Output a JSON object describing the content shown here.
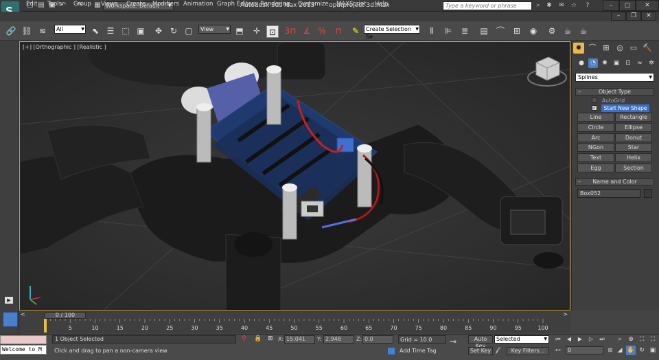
{
  "title_bar": {
    "app_title": "Autodesk 3ds Max 2013",
    "file_name": "opatproject 3d.max",
    "workspace_label": "Workspace: Default",
    "search_placeholder": "Type a keyword or phrase"
  },
  "menu": [
    "Edit",
    "Tools",
    "Group",
    "Views",
    "Create",
    "Modifiers",
    "Animation",
    "Graph Editors",
    "Rendering",
    "Customize",
    "MAXScript",
    "Help"
  ],
  "toolbar": {
    "selection_filter": "All",
    "reference_coord": "View",
    "named_selection": "Create Selection Se",
    "snap_label": "3"
  },
  "viewport": {
    "label": "[+] [Orthographic ] [Realistic ]"
  },
  "command_panel": {
    "category": "Splines",
    "object_type_title": "Object Type",
    "autogrid_label": "AutoGrid",
    "start_new_shape_label": "Start New Shape",
    "buttons": [
      "Line",
      "Rectangle",
      "Circle",
      "Ellipse",
      "Arc",
      "Donut",
      "NGon",
      "Star",
      "Text",
      "Helix",
      "Egg",
      "Section"
    ],
    "name_color_title": "Name and Color",
    "object_name": "Box052"
  },
  "timeline": {
    "position": "0 / 100",
    "ticks": [
      "0",
      "5",
      "10",
      "15",
      "20",
      "25",
      "30",
      "35",
      "40",
      "45",
      "50",
      "55",
      "60",
      "65",
      "70",
      "75",
      "80",
      "85",
      "90",
      "95",
      "100"
    ]
  },
  "status": {
    "maxscript_text": "Welcome to M",
    "selection_info": "1 Object Selected",
    "prompt": "Click and drag to pan a non-camera view",
    "x_label": "X:",
    "x_value": "15.041",
    "y_label": "Y:",
    "y_value": "2.948",
    "z_label": "Z:",
    "z_value": "0.0",
    "grid": "Grid = 10.0",
    "add_time_tag": "Add Time Tag",
    "auto_key": "Auto Key",
    "set_key": "Set Key",
    "selected": "Selected",
    "key_filters": "Key Filters...",
    "frame": "0"
  }
}
